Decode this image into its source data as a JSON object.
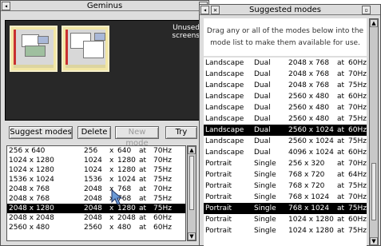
{
  "geminus": {
    "title": "Geminus",
    "unused_label": "Unused screens",
    "buttons": {
      "suggest": "Suggest modes",
      "delete": "Delete",
      "new_mode": "New mode",
      "try": "Try"
    },
    "modes": [
      {
        "name": "256 x 640",
        "w": "256",
        "h": "640",
        "at": "at",
        "hz": "70Hz",
        "selected": false
      },
      {
        "name": "1024 x 1280",
        "w": "1024",
        "h": "1280",
        "at": "at",
        "hz": "70Hz",
        "selected": false
      },
      {
        "name": "1024 x 1280",
        "w": "1024",
        "h": "1280",
        "at": "at",
        "hz": "75Hz",
        "selected": false
      },
      {
        "name": "1536 x 1024",
        "w": "1536",
        "h": "1024",
        "at": "at",
        "hz": "75Hz",
        "selected": false
      },
      {
        "name": "2048 x 768",
        "w": "2048",
        "h": "768",
        "at": "at",
        "hz": "70Hz",
        "selected": false
      },
      {
        "name": "2048 x 768",
        "w": "2048",
        "h": "768",
        "at": "at",
        "hz": "75Hz",
        "selected": false
      },
      {
        "name": "2048 x 1280",
        "w": "2048",
        "h": "1280",
        "at": "at",
        "hz": "75Hz",
        "selected": true
      },
      {
        "name": "2048 x 2048",
        "w": "2048",
        "h": "2048",
        "at": "at",
        "hz": "60Hz",
        "selected": false
      },
      {
        "name": "2560 x 480",
        "w": "2560",
        "h": "480",
        "at": "at",
        "hz": "60Hz",
        "selected": false
      }
    ]
  },
  "suggested": {
    "title": "Suggested modes",
    "description": "Drag any or all of the modes below into the mode list to make them available for use.",
    "modes": [
      {
        "orientation": "Landscape",
        "kind": "Dual",
        "res": "2048 x 768",
        "at": "at",
        "hz": "60Hz",
        "selected": false
      },
      {
        "orientation": "Landscape",
        "kind": "Dual",
        "res": "2048 x 768",
        "at": "at",
        "hz": "70Hz",
        "selected": false
      },
      {
        "orientation": "Landscape",
        "kind": "Dual",
        "res": "2048 x 768",
        "at": "at",
        "hz": "75Hz",
        "selected": false
      },
      {
        "orientation": "Landscape",
        "kind": "Dual",
        "res": "2560 x 480",
        "at": "at",
        "hz": "60Hz",
        "selected": false
      },
      {
        "orientation": "Landscape",
        "kind": "Dual",
        "res": "2560 x 480",
        "at": "at",
        "hz": "70Hz",
        "selected": false
      },
      {
        "orientation": "Landscape",
        "kind": "Dual",
        "res": "2560 x 480",
        "at": "at",
        "hz": "75Hz",
        "selected": false
      },
      {
        "orientation": "Landscape",
        "kind": "Dual",
        "res": "2560 x 1024",
        "at": "at",
        "hz": "60Hz",
        "selected": true
      },
      {
        "orientation": "Landscape",
        "kind": "Dual",
        "res": "2560 x 1024",
        "at": "at",
        "hz": "75Hz",
        "selected": false
      },
      {
        "orientation": "Landscape",
        "kind": "Dual",
        "res": "4096 x 1024",
        "at": "at",
        "hz": "60Hz",
        "selected": false
      },
      {
        "orientation": "Portrait",
        "kind": "Single",
        "res": "256 x 320",
        "at": "at",
        "hz": "70Hz",
        "selected": false
      },
      {
        "orientation": "Portrait",
        "kind": "Single",
        "res": "768 x 720",
        "at": "at",
        "hz": "64Hz",
        "selected": false
      },
      {
        "orientation": "Portrait",
        "kind": "Single",
        "res": "768 x 720",
        "at": "at",
        "hz": "75Hz",
        "selected": false
      },
      {
        "orientation": "Portrait",
        "kind": "Single",
        "res": "768 x 1024",
        "at": "at",
        "hz": "70Hz",
        "selected": false
      },
      {
        "orientation": "Portrait",
        "kind": "Single",
        "res": "768 x 1024",
        "at": "at",
        "hz": "75Hz",
        "selected": true
      },
      {
        "orientation": "Portrait",
        "kind": "Single",
        "res": "1024 x 1280",
        "at": "at",
        "hz": "60Hz",
        "selected": false
      },
      {
        "orientation": "Portrait",
        "kind": "Single",
        "res": "1024 x 1280",
        "at": "at",
        "hz": "75Hz",
        "selected": false
      }
    ]
  },
  "icons": {
    "close": "close-icon",
    "back": "back-icon",
    "toggle": "toggle-size-icon",
    "scroll_up": "scroll-up-arrow-icon",
    "scroll_down": "scroll-down-arrow-icon",
    "pointer": "pointer-cursor-icon"
  },
  "colors": {
    "window_bg": "#dddddd",
    "screens_bg": "#282828",
    "selection": "#000000",
    "thumb_frame": "#f2e6a4"
  }
}
